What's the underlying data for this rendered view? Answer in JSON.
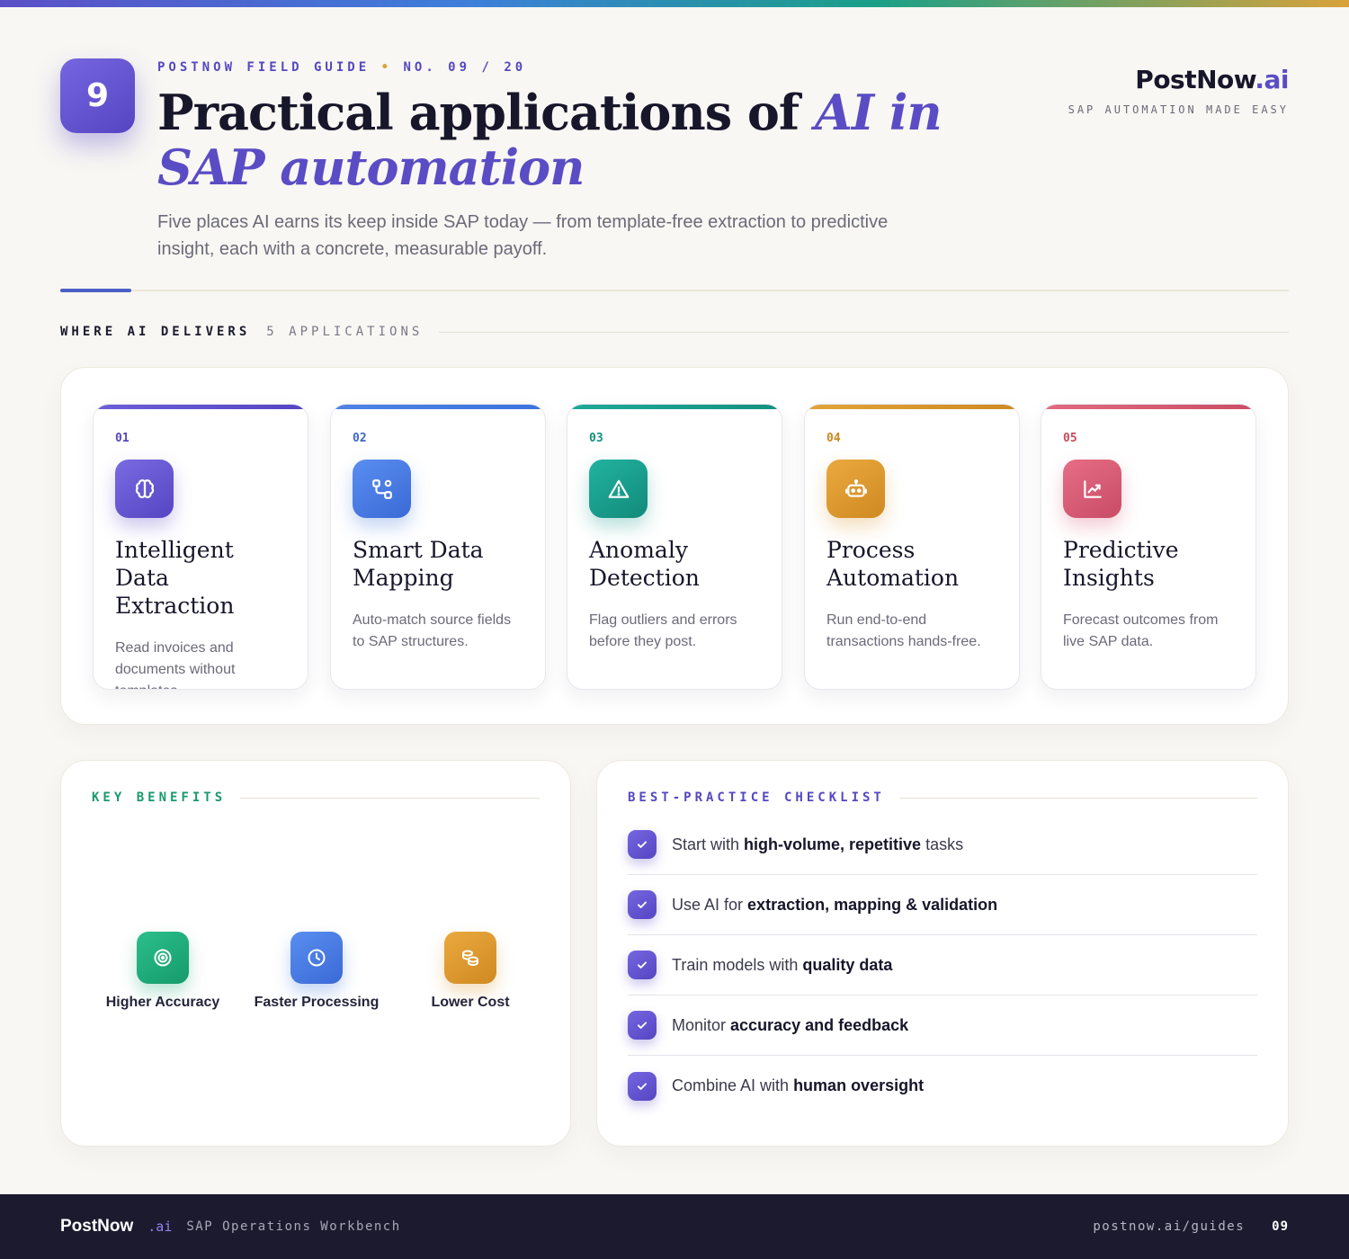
{
  "header": {
    "badge_number": "9",
    "kicker_series": "POSTNOW FIELD GUIDE",
    "kicker_dot": "•",
    "kicker_issue": "NO. 09 / 20",
    "title_part1": "Practical applications of ",
    "title_accent": "AI in SAP automation",
    "subtitle": "Five places AI earns its keep inside SAP today — from template-free extraction to predictive insight, each with a concrete, measurable payoff."
  },
  "brand": {
    "name": "PostNow",
    "suffix": ".ai",
    "tagline": "SAP AUTOMATION MADE EASY"
  },
  "section": {
    "label": "WHERE AI DELIVERS",
    "count": "5 APPLICATIONS"
  },
  "applications": [
    {
      "number": "01",
      "icon": "brain-icon",
      "title": "Intelligent Data Extraction",
      "description": "Read invoices and documents without templates.",
      "color": "#5f4fcf"
    },
    {
      "number": "02",
      "icon": "workflow-icon",
      "title": "Smart Data Mapping",
      "description": "Auto-match source fields to SAP structures.",
      "color": "#3d73dc"
    },
    {
      "number": "03",
      "icon": "warning-icon",
      "title": "Anomaly Detection",
      "description": "Flag outliers and errors before they post.",
      "color": "#17998a"
    },
    {
      "number": "04",
      "icon": "robot-icon",
      "title": "Process Automation",
      "description": "Run end-to-end transactions hands-free.",
      "color": "#d9962a"
    },
    {
      "number": "05",
      "icon": "chart-line-icon",
      "title": "Predictive Insights",
      "description": "Forecast outcomes from live SAP data.",
      "color": "#d85a73"
    }
  ],
  "benefits": {
    "heading": "KEY BENEFITS",
    "heading_color": "#1a9a6c",
    "items": [
      {
        "icon": "target-icon",
        "label": "Higher Accuracy",
        "color": "#1eaa7a"
      },
      {
        "icon": "clock-icon",
        "label": "Faster Processing",
        "color": "#3d73dc"
      },
      {
        "icon": "coins-icon",
        "label": "Lower Cost",
        "color": "#d9962a"
      }
    ]
  },
  "checklist": {
    "heading": "BEST-PRACTICE CHECKLIST",
    "heading_color": "#5548c0",
    "items": [
      {
        "pre": "Start with ",
        "bold": "high-volume, repetitive",
        "post": " tasks"
      },
      {
        "pre": "Use AI for ",
        "bold": "extraction, mapping & validation",
        "post": ""
      },
      {
        "pre": "Train models with ",
        "bold": "quality data",
        "post": ""
      },
      {
        "pre": "Monitor ",
        "bold": "accuracy and feedback",
        "post": ""
      },
      {
        "pre": "Combine AI with ",
        "bold": "human oversight",
        "post": ""
      }
    ]
  },
  "footer": {
    "brand": "PostNow",
    "suffix": ".ai",
    "product": "SAP Operations Workbench",
    "url": "postnow.ai/guides",
    "page": "09"
  }
}
